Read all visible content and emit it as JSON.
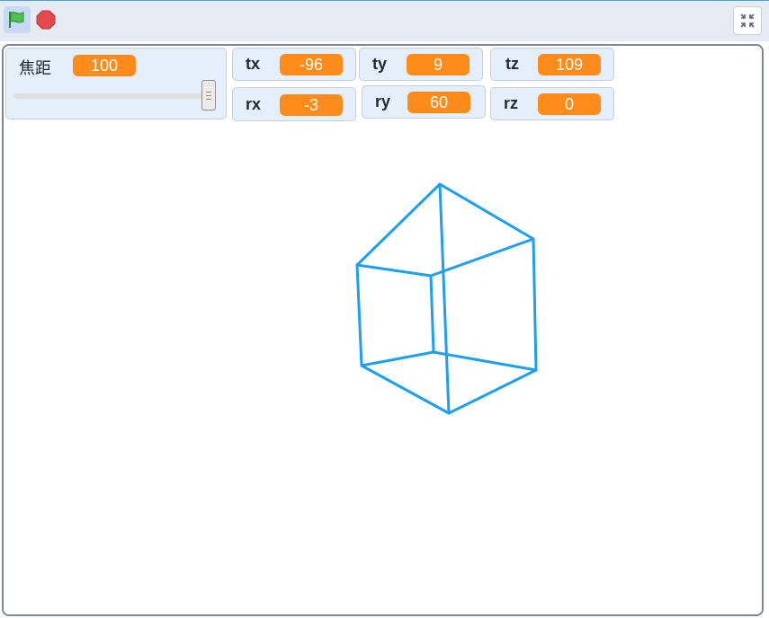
{
  "toolbar": {
    "green_flag_icon": "green-flag-icon",
    "stop_icon": "stop-icon",
    "fullscreen_icon": "shrink-icon",
    "flag_color": "#4cbf56",
    "stop_color": "#e5484d"
  },
  "monitors": {
    "focal": {
      "label": "焦距",
      "value": "100",
      "slider_level": 1.0
    },
    "tx": {
      "label": "tx",
      "value": "-96"
    },
    "ty": {
      "label": "ty",
      "value": "9"
    },
    "tz": {
      "label": "tz",
      "value": "109"
    },
    "rx": {
      "label": "rx",
      "value": "-3"
    },
    "ry": {
      "label": "ry",
      "value": "60"
    },
    "rz": {
      "label": "rz",
      "value": "0"
    }
  },
  "colors": {
    "accent": "#ff8c1a",
    "wireframe": "#1e9ff2",
    "monitor_bg": "#e5eefb"
  }
}
